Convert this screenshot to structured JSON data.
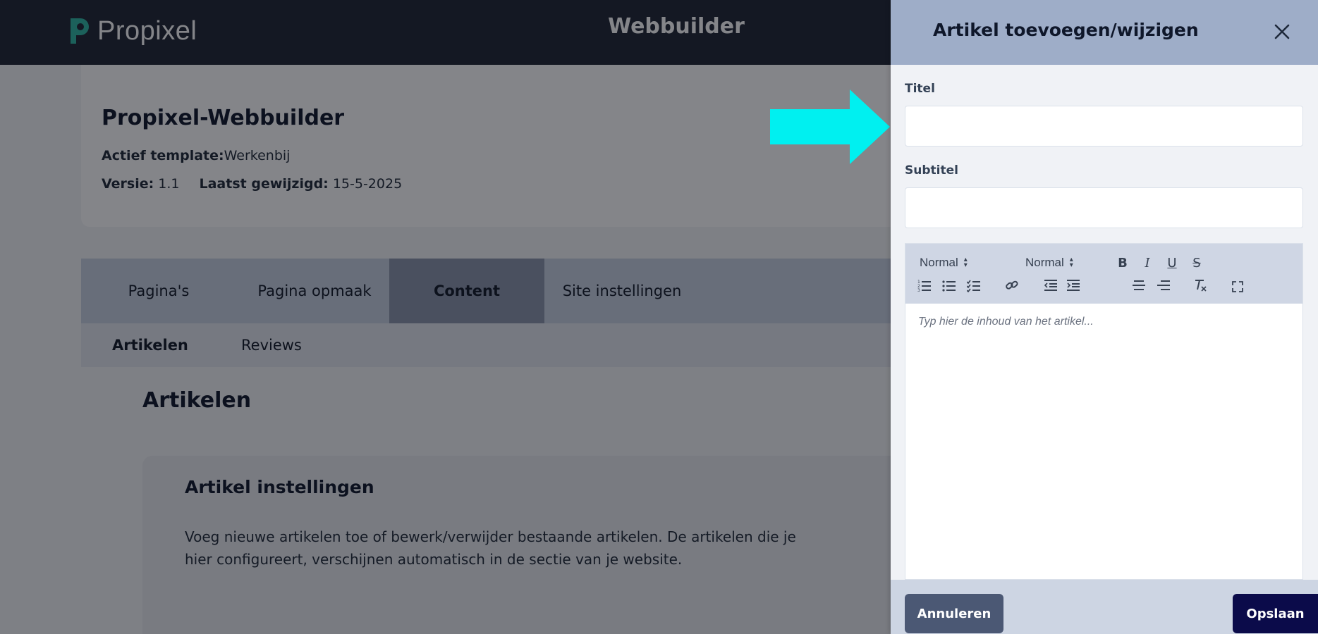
{
  "header": {
    "brand": "Propixel",
    "app_title": "Webbuilder"
  },
  "site": {
    "name": "Propixel-Webbuilder",
    "template_label": "Actief template:",
    "template_value": "Werkenbij",
    "version_label": "Versie:",
    "version_value": "1.1",
    "modified_label": "Laatst gewijzigd:",
    "modified_value": "15-5-2025"
  },
  "tabs": [
    {
      "label": "Pagina's"
    },
    {
      "label": "Pagina opmaak"
    },
    {
      "label": "Content",
      "active": true
    },
    {
      "label": "Site instellingen"
    }
  ],
  "subtabs": [
    {
      "label": "Artikelen",
      "active": true
    },
    {
      "label": "Reviews"
    }
  ],
  "section": {
    "title": "Artikelen",
    "card_title": "Artikel instellingen",
    "card_desc": "Voeg nieuwe artikelen toe of bewerk/verwijder bestaande artikelen. De artikelen die je hier configureert, verschijnen automatisch in de sectie van je website."
  },
  "panel": {
    "title": "Artikel toevoegen/wijzigen",
    "title_label": "Titel",
    "title_value": "",
    "subtitle_label": "Subtitel",
    "subtitle_value": "",
    "toolbar": {
      "header_select": "Normal",
      "size_select": "Normal",
      "bold": "B",
      "italic": "I",
      "underline": "U",
      "strike": "S"
    },
    "editor_placeholder": "Typ hier de inhoud van het artikel...",
    "cancel_label": "Annuleren",
    "save_label": "Opslaan"
  },
  "colors": {
    "annotation_arrow": "#00f0f0",
    "save_button": "#0b0b4a",
    "panel_header": "#9eadc8"
  }
}
